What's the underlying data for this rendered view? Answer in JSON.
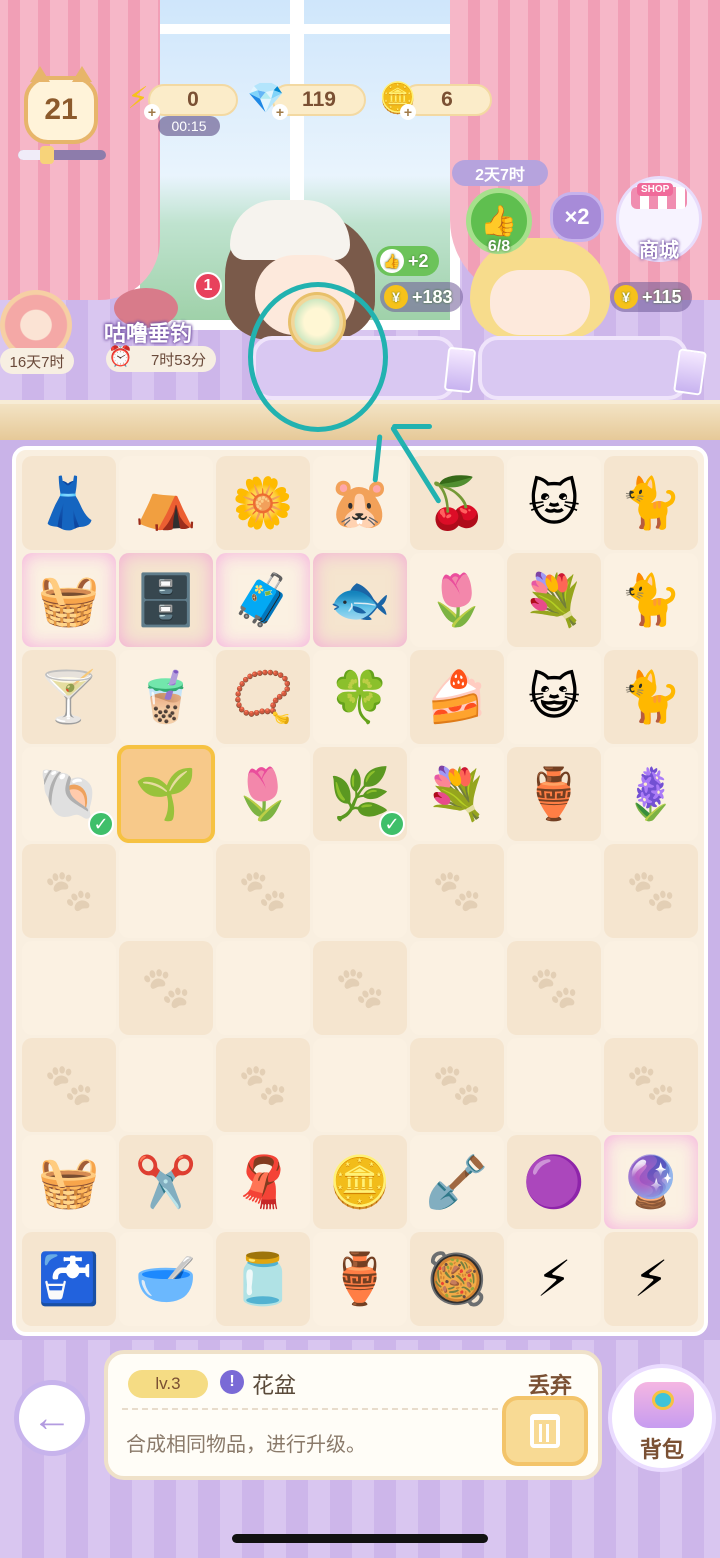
{
  "hud": {
    "level": "21",
    "level_progress": 0.3,
    "energy": "0",
    "energy_timer": "00:15",
    "gems": "119",
    "coins": "6"
  },
  "left_items": {
    "roll_timer": "16天7时",
    "fishing_label": "咕噜垂钓",
    "fishing_timer": "7时53分",
    "notification_count": "1"
  },
  "right_items": {
    "event_time": "2天7时",
    "likes": "6/8",
    "multiplier": "×2",
    "shop_sign": "SHOP",
    "shop_label": "商城"
  },
  "customers": [
    {
      "like_bonus": "+2",
      "coin_reward": "+183"
    },
    {
      "coin_reward": "+115"
    }
  ],
  "board": {
    "rows": [
      [
        {
          "icon": "👗",
          "name": "dress"
        },
        {
          "icon": "⛺",
          "name": "teepee-tent"
        },
        {
          "icon": "🌼",
          "name": "white-flowers"
        },
        {
          "icon": "🐹",
          "name": "hamster-taco"
        },
        {
          "icon": "🍒",
          "name": "berry-basket"
        },
        {
          "icon": "🐱",
          "name": "calico-cat-crown"
        },
        {
          "icon": "🐈",
          "name": "lucky-cat"
        }
      ],
      [
        {
          "icon": "🧺",
          "name": "clothes-rack",
          "glow": true
        },
        {
          "icon": "🗄️",
          "name": "jewelry-box",
          "glow": true
        },
        {
          "icon": "🧳",
          "name": "open-trunk",
          "glow": true
        },
        {
          "icon": "🐟",
          "name": "fishbowl",
          "glow": true
        },
        {
          "icon": "🌷",
          "name": "flower-shelf"
        },
        {
          "icon": "💐",
          "name": "purple-bouquet"
        },
        {
          "icon": "🐈",
          "name": "calico-cat"
        }
      ],
      [
        {
          "icon": "🍸",
          "name": "glass-with-ribbon"
        },
        {
          "icon": "🧋",
          "name": "iced-tea"
        },
        {
          "icon": "📿",
          "name": "pearl-headband"
        },
        {
          "icon": "🍀",
          "name": "green-flower"
        },
        {
          "icon": "🍰",
          "name": "matcha-cake"
        },
        {
          "icon": "😺",
          "name": "siamese-cat"
        },
        {
          "icon": "🐈",
          "name": "tricolor-cat"
        }
      ],
      [
        {
          "icon": "🐚",
          "name": "seashell",
          "check": true
        },
        {
          "icon": "🌱",
          "name": "flower-pot",
          "selected": true
        },
        {
          "icon": "🌷",
          "name": "tulip"
        },
        {
          "icon": "🌿",
          "name": "lily-of-the-valley",
          "check": true
        },
        {
          "icon": "💐",
          "name": "white-bouquet"
        },
        {
          "icon": "🏺",
          "name": "pink-vase"
        },
        {
          "icon": "🪻",
          "name": "purple-bells"
        }
      ],
      [
        {},
        {},
        {},
        {},
        {},
        {},
        {}
      ],
      [
        {},
        {},
        {},
        {},
        {},
        {},
        {}
      ],
      [
        {},
        {},
        {},
        {},
        {},
        {},
        {}
      ],
      [
        {
          "icon": "🧺",
          "name": "sand-bucket"
        },
        {
          "icon": "✂️",
          "name": "garden-shears"
        },
        {
          "icon": "🧣",
          "name": "towel-rack"
        },
        {
          "icon": "🪙",
          "name": "coins"
        },
        {
          "icon": "🪏",
          "name": "shovel"
        },
        {
          "icon": "🟣",
          "name": "pink-dough"
        },
        {
          "icon": "🔮",
          "name": "gem-capsule",
          "glow": true
        }
      ],
      [
        {
          "icon": "🚰",
          "name": "water-dispenser"
        },
        {
          "icon": "🥣",
          "name": "food-bowl"
        },
        {
          "icon": "🫙",
          "name": "berry-jar"
        },
        {
          "icon": "🏺",
          "name": "honey-jar"
        },
        {
          "icon": "🥘",
          "name": "pet-bowl"
        },
        {
          "icon": "⚡",
          "name": "energy-small"
        },
        {
          "icon": "⚡",
          "name": "energy-large"
        }
      ]
    ]
  },
  "item_panel": {
    "level": "lv.3",
    "name": "花盆",
    "description": "合成相同物品，进行升级。",
    "discard_label": "丢弃",
    "bag_label": "背包"
  },
  "colors": {
    "accent_purple": "#c7b3ec",
    "annotation": "#22b2b0",
    "selected_outline": "#f6c242"
  }
}
